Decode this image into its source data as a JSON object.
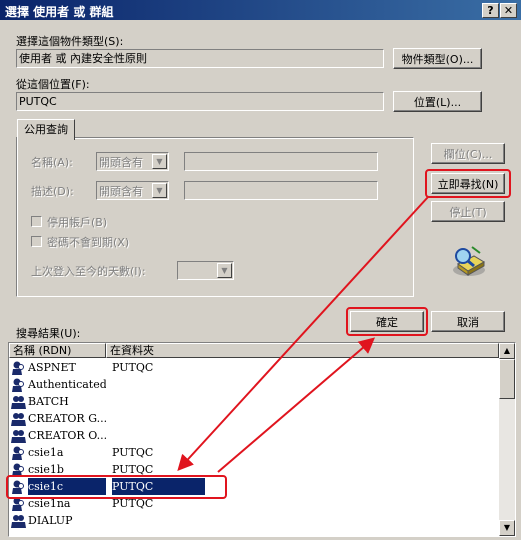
{
  "window": {
    "title": "選擇 使用者 或 群組",
    "help_button": "?",
    "close_button": "✕"
  },
  "object_type": {
    "label": "選擇這個物件類型(S):",
    "value": "使用者 或 內建安全性原則",
    "button": "物件類型(O)..."
  },
  "location": {
    "label": "從這個位置(F):",
    "value": "PUTQC",
    "button": "位置(L)..."
  },
  "query_tab": {
    "label": "公用查詢"
  },
  "query": {
    "name_label": "名稱(A):",
    "name_mode": "開頭含有",
    "desc_label": "描述(D):",
    "desc_mode": "開頭含有",
    "disabled_accounts": "停用帳戶(B)",
    "non_expiring_pw": "密碼不會到期(X)",
    "days_since_logon": "上次登入至今的天數(I):"
  },
  "side_buttons": {
    "columns": "欄位(C)...",
    "find_now": "立即尋找(N)",
    "stop": "停止(T)"
  },
  "ok_button": "確定",
  "cancel_button": "取消",
  "results": {
    "label": "搜尋結果(U):",
    "columns": [
      "名稱 (RDN)",
      "在資料夾"
    ],
    "rows": [
      {
        "name": "ASPNET",
        "folder": "PUTQC"
      },
      {
        "name": "Authenticated ...",
        "folder": ""
      },
      {
        "name": "BATCH",
        "folder": ""
      },
      {
        "name": "CREATOR G...",
        "folder": ""
      },
      {
        "name": "CREATOR O...",
        "folder": ""
      },
      {
        "name": "csie1a",
        "folder": "PUTQC"
      },
      {
        "name": "csie1b",
        "folder": "PUTQC"
      },
      {
        "name": "csie1c",
        "folder": "PUTQC"
      },
      {
        "name": "csie1na",
        "folder": "PUTQC"
      },
      {
        "name": "DIALUP",
        "folder": ""
      }
    ],
    "selected_row": 7
  },
  "colors": {
    "title_bar": "#0a246a",
    "selection": "#0a246a",
    "annotation": "#e0141e"
  }
}
